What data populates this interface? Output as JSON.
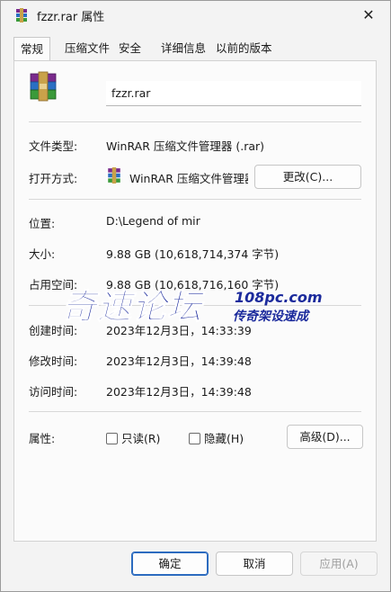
{
  "window": {
    "title": "fzzr.rar 属性",
    "close_glyph": "✕"
  },
  "tabs": [
    {
      "label": "常规"
    },
    {
      "label": "压缩文件"
    },
    {
      "label": "安全"
    },
    {
      "label": "详细信息"
    },
    {
      "label": "以前的版本"
    }
  ],
  "general": {
    "file_name": "fzzr.rar",
    "type_label": "文件类型:",
    "type_value": "WinRAR 压缩文件管理器 (.rar)",
    "open_label": "打开方式:",
    "open_value": "WinRAR 压缩文件管理器",
    "change_button": "更改(C)...",
    "location_label": "位置:",
    "location_value": "D:\\Legend of mir",
    "size_label": "大小:",
    "size_value": "9.88 GB (10,618,714,374 字节)",
    "disk_label": "占用空间:",
    "disk_value": "9.88 GB (10,618,716,160 字节)",
    "created_label": "创建时间:",
    "created_value": "2023年12月3日，14:33:39",
    "modified_label": "修改时间:",
    "modified_value": "2023年12月3日，14:39:48",
    "accessed_label": "访问时间:",
    "accessed_value": "2023年12月3日，14:39:48",
    "attr_label": "属性:",
    "readonly_label": "只读(R)",
    "hidden_label": "隐藏(H)",
    "advanced_button": "高级(D)..."
  },
  "watermark": {
    "main": "奇速论坛",
    "url": "108pc.com",
    "sub": "传奇架设速成"
  },
  "footer": {
    "ok": "确定",
    "cancel": "取消",
    "apply": "应用(A)"
  },
  "colors": {
    "accent": "#2c6bbf",
    "watermark": "#1b2a9c"
  },
  "icons": {
    "app": "winrar-archive-icon",
    "close": "close-icon"
  }
}
